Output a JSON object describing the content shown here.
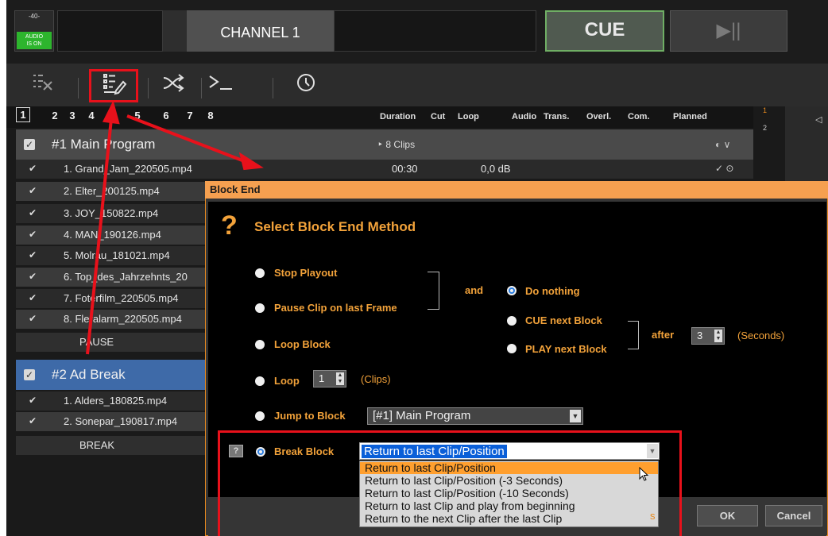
{
  "top": {
    "audio_level": "-40-",
    "audio_badge_line1": "AUDIO",
    "audio_badge_line2": "IS ON",
    "channel_name": "CHANNEL 1",
    "cue_label": "CUE",
    "play_pause_label": "▶||"
  },
  "toolbar": {
    "icons": [
      "remove-list-icon",
      "edit-list-icon",
      "shuffle-icon",
      "console-icon",
      "clock-icon"
    ]
  },
  "pages": [
    "1",
    "2",
    "3",
    "4",
    "5",
    "6",
    "7",
    "8"
  ],
  "columns": {
    "duration": "Duration",
    "cut": "Cut",
    "loop": "Loop",
    "audio": "Audio",
    "trans": "Trans.",
    "overl": "Overl.",
    "com": "Com.",
    "planned": "Planned"
  },
  "side_numbers": [
    "1",
    "2"
  ],
  "block1": {
    "title": "#1 Main Program",
    "clips": "‣ 8 Clips",
    "icons": "◐ ∨",
    "items": [
      {
        "name": "1. Grand_Jam_220505.mp4",
        "duration": "00:30",
        "audio": "0,0 dB",
        "planned": "✓ ⊙"
      },
      {
        "name": "2. Elter_200125.mp4"
      },
      {
        "name": "3. JOY_150822.mp4"
      },
      {
        "name": "4. MAN_190126.mp4"
      },
      {
        "name": "5. Molrau_181021.mp4"
      },
      {
        "name": "6. Top_des_Jahrzehnts_20"
      },
      {
        "name": "7. Foterfilm_220505.mp4"
      },
      {
        "name": "8. Fleralarm_220505.mp4"
      }
    ],
    "end_label": "PAUSE"
  },
  "block2": {
    "title": "#2 Ad Break",
    "items": [
      {
        "name": "1. Alders_180825.mp4"
      },
      {
        "name": "2. Sonepar_190817.mp4"
      }
    ],
    "end_label": "BREAK"
  },
  "dialog": {
    "title": "Block End",
    "heading": "Select Block End Method",
    "opt_stop": "Stop Playout",
    "opt_pause": "Pause Clip on last Frame",
    "opt_loop_block": "Loop Block",
    "opt_loop": "Loop",
    "loop_value": "1",
    "loop_unit": "(Clips)",
    "opt_jump": "Jump to Block",
    "jump_value": "[#1]  Main Program",
    "opt_break": "Break Block",
    "and_label": "and",
    "opt_nothing": "Do nothing",
    "opt_cue_next": "CUE next Block",
    "opt_play_next": "PLAY next Block",
    "after_label": "after",
    "after_value": "3",
    "after_unit": "(Seconds)",
    "help_label": "?",
    "break_selected": "Return to last Clip/Position",
    "break_options": [
      "Return to last Clip/Position",
      "Return to last Clip/Position (-3 Seconds)",
      "Return to last Clip/Position (-10 Seconds)",
      "Return to last Clip and play from beginning",
      "Return to the next Clip after the last Clip"
    ],
    "footer_frag": "s",
    "ok_label": "OK",
    "cancel_label": "Cancel"
  },
  "colors": {
    "accent_orange": "#f2a23a",
    "annotation_red": "#e8111b",
    "selection_blue": "#0a5fd8",
    "cue_green": "#6fae64"
  }
}
